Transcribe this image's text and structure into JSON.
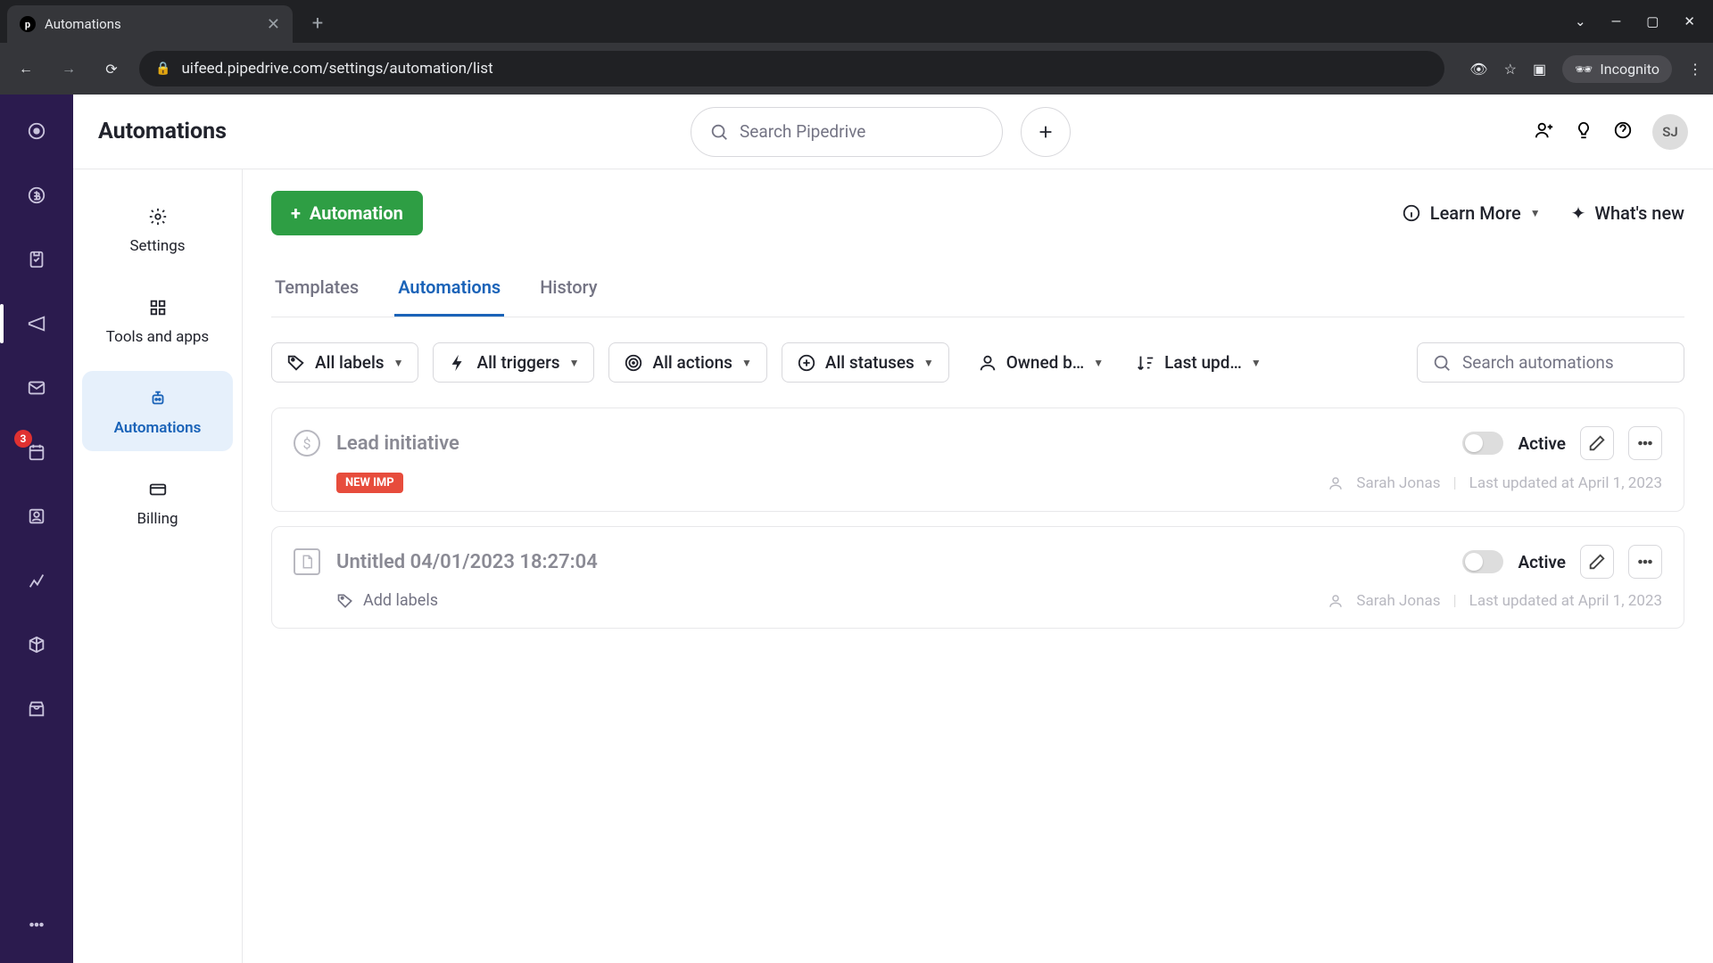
{
  "browser": {
    "tab_title": "Automations",
    "url": "uifeed.pipedrive.com/settings/automation/list",
    "incognito_label": "Incognito"
  },
  "header": {
    "title": "Automations",
    "search_placeholder": "Search Pipedrive",
    "avatar_initials": "SJ"
  },
  "rail_badge": "3",
  "sidebar": {
    "items": [
      {
        "label": "Settings"
      },
      {
        "label": "Tools and apps"
      },
      {
        "label": "Automations"
      },
      {
        "label": "Billing"
      }
    ]
  },
  "actions": {
    "primary": "Automation",
    "learn_more": "Learn More",
    "whats_new": "What's new"
  },
  "tabs": [
    "Templates",
    "Automations",
    "History"
  ],
  "filters": {
    "labels": "All labels",
    "triggers": "All triggers",
    "actions": "All actions",
    "statuses": "All statuses",
    "owner": "Owned b…",
    "sort": "Last upd…",
    "search_placeholder": "Search automations"
  },
  "automations": [
    {
      "title": "Lead initiative",
      "tag": "NEW IMP",
      "status": "Active",
      "owner": "Sarah Jonas",
      "updated": "Last updated at April 1, 2023",
      "has_tag": true
    },
    {
      "title": "Untitled 04/01/2023 18:27:04",
      "add_labels": "Add labels",
      "status": "Active",
      "owner": "Sarah Jonas",
      "updated": "Last updated at April 1, 2023",
      "has_tag": false
    }
  ]
}
